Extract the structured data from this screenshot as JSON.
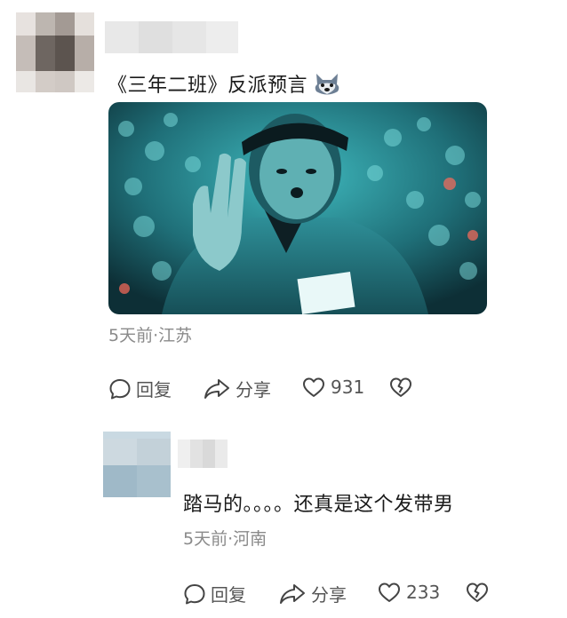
{
  "comments": [
    {
      "text": "《三年二班》反派预言",
      "emoji": "wolf-face-emoji",
      "time_location": "5天前·江苏",
      "actions": {
        "reply": "回复",
        "share": "分享",
        "likes": "931"
      }
    },
    {
      "text": "踏马的。。。。还真是这个发带男",
      "time_location": "5天前·河南",
      "actions": {
        "reply": "回复",
        "share": "分享",
        "likes": "233"
      }
    }
  ],
  "icons": {
    "reply": "comment-bubble-icon",
    "share": "share-arrow-icon",
    "like": "heart-icon",
    "dislike": "broken-heart-icon"
  },
  "colors": {
    "text": "#1a1a1a",
    "meta": "#8a8a8a",
    "photo_tone": "#3aa8b0"
  }
}
